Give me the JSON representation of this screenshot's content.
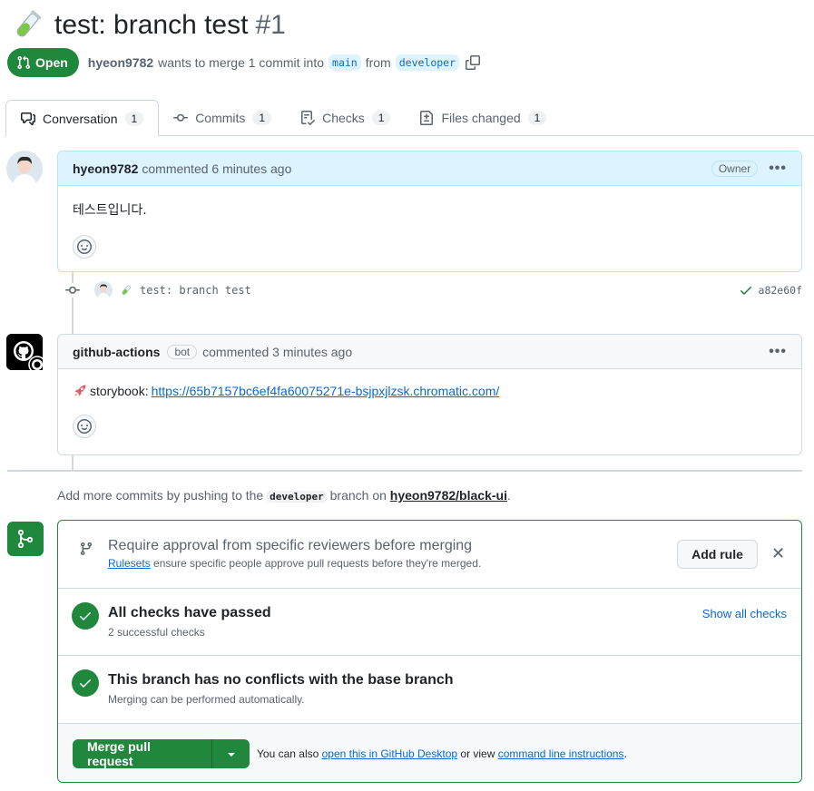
{
  "pr": {
    "title": "test: branch test",
    "number": "#1",
    "state": "Open",
    "author": "hyeon9782",
    "merge_text": "wants to merge 1 commit into",
    "base_branch": "main",
    "from_text": "from",
    "head_branch": "developer"
  },
  "tabs": [
    {
      "label": "Conversation",
      "count": "1",
      "icon": "conversation-icon"
    },
    {
      "label": "Commits",
      "count": "1",
      "icon": "commit-icon"
    },
    {
      "label": "Checks",
      "count": "1",
      "icon": "checklist-icon"
    },
    {
      "label": "Files changed",
      "count": "1",
      "icon": "file-diff-icon"
    }
  ],
  "comments": [
    {
      "author": "hyeon9782",
      "meta": "commented 6 minutes ago",
      "role": "Owner",
      "body": "테스트입니다."
    },
    {
      "author": "github-actions",
      "bot_label": "bot",
      "meta": "commented 3 minutes ago",
      "body_prefix": "storybook:",
      "link": "https://65b7157bc6ef4fa60075271e-bsjpxjlzsk.chromatic.com/"
    }
  ],
  "commit": {
    "message": "test: branch test",
    "sha": "a82e60f"
  },
  "push_hint": {
    "before": "Add more commits by pushing to the",
    "branch": "developer",
    "middle": "branch on",
    "repo": "hyeon9782/black-ui",
    "after": "."
  },
  "merge_box": {
    "rules_title": "Require approval from specific reviewers before merging",
    "rules_link": "Rulesets",
    "rules_sub": "ensure specific people approve pull requests before they're merged.",
    "add_rule_label": "Add rule",
    "checks_title": "All checks have passed",
    "checks_sub": "2 successful checks",
    "show_all_label": "Show all checks",
    "conflicts_title": "This branch has no conflicts with the base branch",
    "conflicts_sub": "Merging can be performed automatically.",
    "merge_button_label": "Merge pull request",
    "note_before": "You can also",
    "note_link1": "open this in GitHub Desktop",
    "note_middle": "or view",
    "note_link2": "command line instructions",
    "note_after": "."
  },
  "colors": {
    "accent_green": "#1f883d",
    "link_blue": "#0969da",
    "owner_header_bg": "#ddf4ff"
  }
}
